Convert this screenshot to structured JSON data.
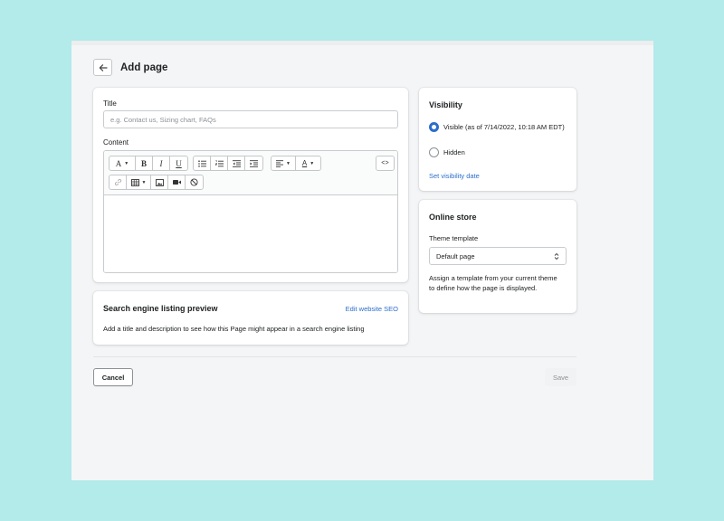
{
  "header": {
    "back_icon": "arrow-left-icon",
    "title": "Add page"
  },
  "main": {
    "title_label": "Title",
    "title_placeholder": "e.g. Contact us, Sizing chart, FAQs",
    "title_value": "",
    "content_label": "Content",
    "toolbar": {
      "row1": [
        {
          "name": "font-format",
          "glyph": "A",
          "dropdown": true
        },
        {
          "name": "bold",
          "glyph": "B"
        },
        {
          "name": "italic",
          "glyph": "I"
        },
        {
          "name": "underline",
          "glyph": "U"
        },
        {
          "name": "bulleted-list",
          "glyph": "☰"
        },
        {
          "name": "numbered-list",
          "glyph": "☷"
        },
        {
          "name": "outdent",
          "glyph": "⇤"
        },
        {
          "name": "indent",
          "glyph": "⇥"
        },
        {
          "name": "align",
          "glyph": "≡",
          "dropdown": true
        },
        {
          "name": "text-color",
          "glyph": "A",
          "dropdown": true
        },
        {
          "name": "show-html",
          "glyph": "<>"
        }
      ],
      "row2": [
        {
          "name": "insert-link",
          "glyph": "🔗"
        },
        {
          "name": "insert-table",
          "glyph": "▦",
          "dropdown": true
        },
        {
          "name": "insert-image",
          "glyph": "▣"
        },
        {
          "name": "insert-video",
          "glyph": "▶"
        },
        {
          "name": "clear-formatting",
          "glyph": "⊘"
        }
      ]
    }
  },
  "seo": {
    "heading": "Search engine listing preview",
    "edit_link": "Edit website SEO",
    "description": "Add a title and description to see how this Page might appear in a search engine listing"
  },
  "visibility": {
    "heading": "Visibility",
    "options": [
      {
        "label": "Visible (as of 7/14/2022, 10:18 AM EDT)",
        "checked": true
      },
      {
        "label": "Hidden",
        "checked": false
      }
    ],
    "set_date_link": "Set visibility date"
  },
  "online_store": {
    "heading": "Online store",
    "template_label": "Theme template",
    "template_value": "Default page",
    "help_text": "Assign a template from your current theme to define how the page is displayed."
  },
  "footer": {
    "cancel_label": "Cancel",
    "save_label": "Save"
  },
  "colors": {
    "background": "#b3eaea",
    "page": "#f4f5f6",
    "link": "#2c6ecb",
    "radio_checked": "#2c6ecb"
  }
}
